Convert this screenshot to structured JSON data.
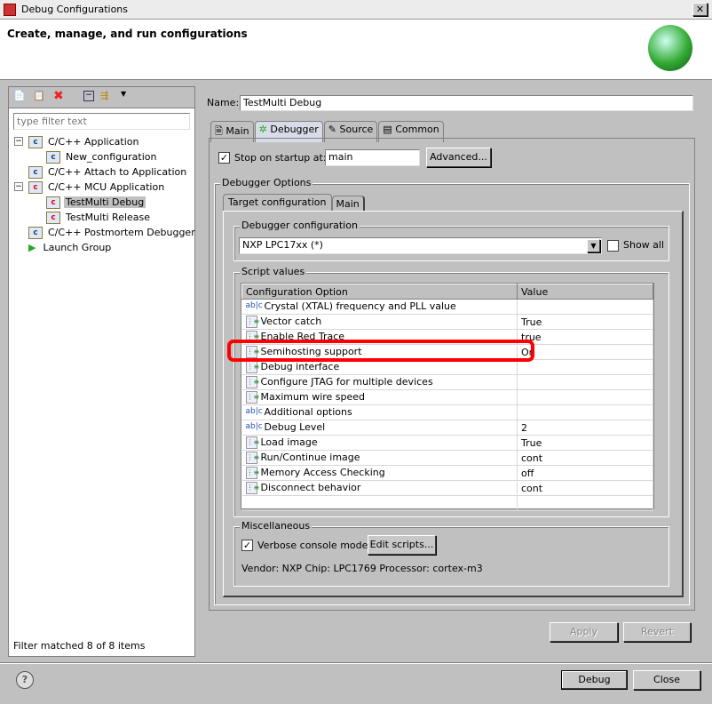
{
  "window": {
    "title": "Debug Configurations",
    "header": "Create, manage, and run configurations"
  },
  "left": {
    "filter_placeholder": "type filter text",
    "status": "Filter matched 8 of 8 items",
    "tree": [
      {
        "label": "C/C++ Application",
        "icon": "c-blue",
        "level": 0,
        "expand": "minus"
      },
      {
        "label": "New_configuration",
        "icon": "c-blue",
        "level": 1
      },
      {
        "label": "C/C++ Attach to Application",
        "icon": "c-blue",
        "level": 0
      },
      {
        "label": "C/C++ MCU Application",
        "icon": "c-red",
        "level": 0,
        "expand": "minus"
      },
      {
        "label": "TestMulti Debug",
        "icon": "c-red",
        "level": 1,
        "selected": true
      },
      {
        "label": "TestMulti Release",
        "icon": "c-red",
        "level": 1
      },
      {
        "label": "C/C++ Postmortem Debugger",
        "icon": "c-blue",
        "level": 0
      },
      {
        "label": "Launch Group",
        "icon": "play-green",
        "level": 0
      }
    ]
  },
  "main": {
    "name_label": "Name:",
    "name_value": "TestMulti Debug",
    "tabs": [
      "Main",
      "Debugger",
      "Source",
      "Common"
    ],
    "active_tab": "Debugger",
    "stop_label": "Stop on startup at:",
    "stop_checked": true,
    "stop_value": "main",
    "advanced": "Advanced...",
    "options_group": "Debugger Options",
    "inner_tabs": [
      "Target configuration",
      "Main"
    ],
    "dbg_config_group": "Debugger configuration",
    "dbg_config_value": "NXP LPC17xx (*)",
    "show_all": "Show all",
    "script_group": "Script values",
    "columns": [
      "Configuration Option",
      "Value"
    ],
    "rows": [
      {
        "icon": "abc",
        "option": "Crystal (XTAL) frequency and PLL value",
        "value": ""
      },
      {
        "icon": "list",
        "option": "Vector catch",
        "value": "True"
      },
      {
        "icon": "list",
        "option": "Enable Red Trace",
        "value": "true"
      },
      {
        "icon": "list",
        "option": "Semihosting support",
        "value": "On",
        "highlighted": true
      },
      {
        "icon": "list",
        "option": "Debug interface",
        "value": ""
      },
      {
        "icon": "list",
        "option": "Configure JTAG for multiple devices",
        "value": ""
      },
      {
        "icon": "list",
        "option": "Maximum wire speed",
        "value": ""
      },
      {
        "icon": "abc",
        "option": "Additional options",
        "value": ""
      },
      {
        "icon": "abc",
        "option": "Debug Level",
        "value": "2"
      },
      {
        "icon": "list",
        "option": "Load image",
        "value": "True"
      },
      {
        "icon": "list",
        "option": "Run/Continue image",
        "value": "cont"
      },
      {
        "icon": "list",
        "option": "Memory Access Checking",
        "value": "off"
      },
      {
        "icon": "list",
        "option": "Disconnect behavior",
        "value": "cont"
      }
    ],
    "misc_group": "Miscellaneous",
    "verbose": "Verbose console mode",
    "verbose_checked": true,
    "edit_scripts": "Edit scripts...",
    "vendor": "Vendor: NXP Chip: LPC1769 Processor: cortex-m3",
    "apply": "Apply",
    "revert": "Revert"
  },
  "footer": {
    "debug": "Debug",
    "close": "Close"
  },
  "colors": {
    "highlight": "#ff0000",
    "selection": "#c0c0c0"
  }
}
